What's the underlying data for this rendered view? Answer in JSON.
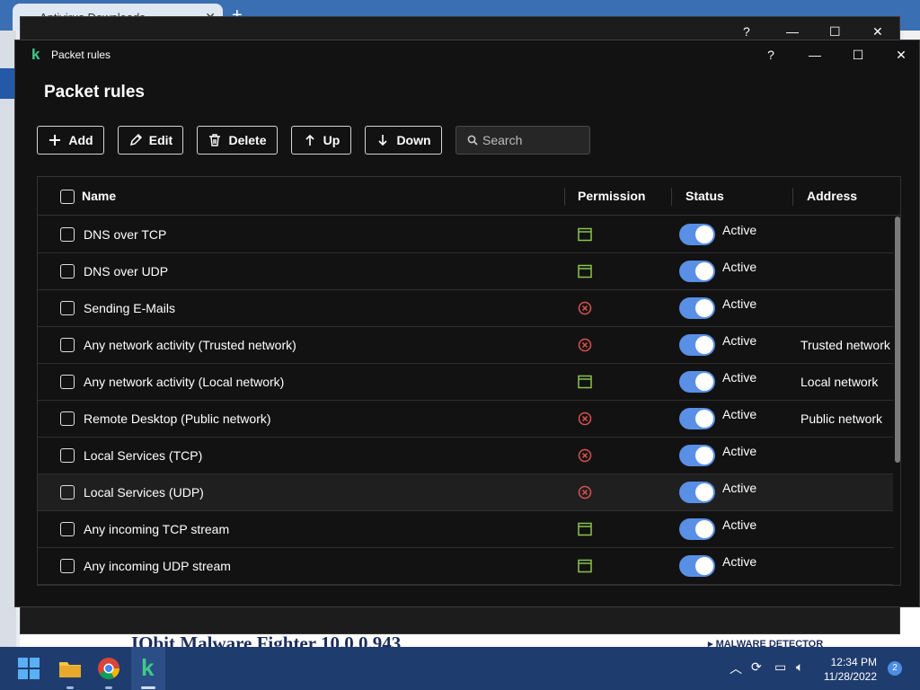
{
  "background": {
    "browser_tab_title": "Antivirus Downloads",
    "page_heading": "IObit Malware Fighter 10.0.0.943",
    "side_label": "MALWARE DETECTOR"
  },
  "window": {
    "title": "Packet rules",
    "help_label": "?",
    "minimize_label": "—",
    "maximize_label": "☐",
    "close_label": "✕"
  },
  "page_title": "Packet rules",
  "toolbar": {
    "add_label": "Add",
    "edit_label": "Edit",
    "delete_label": "Delete",
    "up_label": "Up",
    "down_label": "Down",
    "search_placeholder": "Search"
  },
  "table": {
    "columns": {
      "name": "Name",
      "permission": "Permission",
      "status": "Status",
      "address": "Address"
    },
    "rows": [
      {
        "name": "DNS over TCP",
        "permission": "allow",
        "status": "Active",
        "address": ""
      },
      {
        "name": "DNS over UDP",
        "permission": "allow",
        "status": "Active",
        "address": ""
      },
      {
        "name": "Sending E-Mails",
        "permission": "block",
        "status": "Active",
        "address": ""
      },
      {
        "name": "Any network activity (Trusted network)",
        "permission": "block",
        "status": "Active",
        "address": "Trusted network"
      },
      {
        "name": "Any network activity (Local network)",
        "permission": "allow",
        "status": "Active",
        "address": "Local network"
      },
      {
        "name": "Remote Desktop (Public network)",
        "permission": "block",
        "status": "Active",
        "address": "Public network"
      },
      {
        "name": "Local Services (TCP)",
        "permission": "block",
        "status": "Active",
        "address": ""
      },
      {
        "name": "Local Services (UDP)",
        "permission": "block",
        "status": "Active",
        "address": ""
      },
      {
        "name": "Any incoming TCP stream",
        "permission": "allow",
        "status": "Active",
        "address": ""
      },
      {
        "name": "Any incoming UDP stream",
        "permission": "allow",
        "status": "Active",
        "address": ""
      }
    ]
  },
  "colors": {
    "allow": "#8bc34a",
    "block": "#d9534f",
    "toggle_on": "#5a8fe6",
    "brand": "#3fc98a"
  },
  "taskbar": {
    "time": "12:34 PM",
    "date": "11/28/2022",
    "notification_count": "2"
  }
}
